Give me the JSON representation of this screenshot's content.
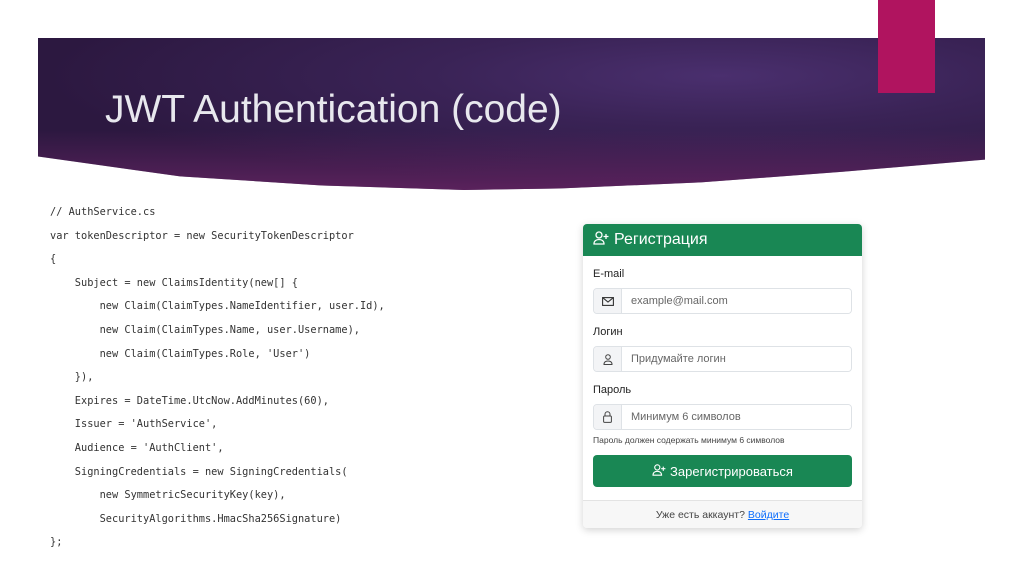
{
  "slide": {
    "title": "JWT Authentication (code)"
  },
  "code_lines": [
    "// AuthService.cs",
    "var tokenDescriptor = new SecurityTokenDescriptor",
    "{",
    "    Subject = new ClaimsIdentity(new[] {",
    "        new Claim(ClaimTypes.NameIdentifier, user.Id),",
    "        new Claim(ClaimTypes.Name, user.Username),",
    "        new Claim(ClaimTypes.Role, 'User')",
    "    }),",
    "    Expires = DateTime.UtcNow.AddMinutes(60),",
    "    Issuer = 'AuthService',",
    "    Audience = 'AuthClient',",
    "    SigningCredentials = new SigningCredentials(",
    "        new SymmetricSecurityKey(key),",
    "        SecurityAlgorithms.HmacSha256Signature)",
    "};"
  ],
  "form": {
    "title": "Регистрация",
    "email": {
      "label": "E-mail",
      "placeholder": "example@mail.com",
      "value": ""
    },
    "login": {
      "label": "Логин",
      "placeholder": "Придумайте логин",
      "value": ""
    },
    "password": {
      "label": "Пароль",
      "placeholder": "Минимум 6 символов",
      "value": "",
      "help": "Пароль должен содержать минимум 6 символов"
    },
    "submit_label": "Зарегистрироваться",
    "footer_text": "Уже есть аккаунт?",
    "footer_link": "Войдите",
    "accent": "#198754"
  }
}
